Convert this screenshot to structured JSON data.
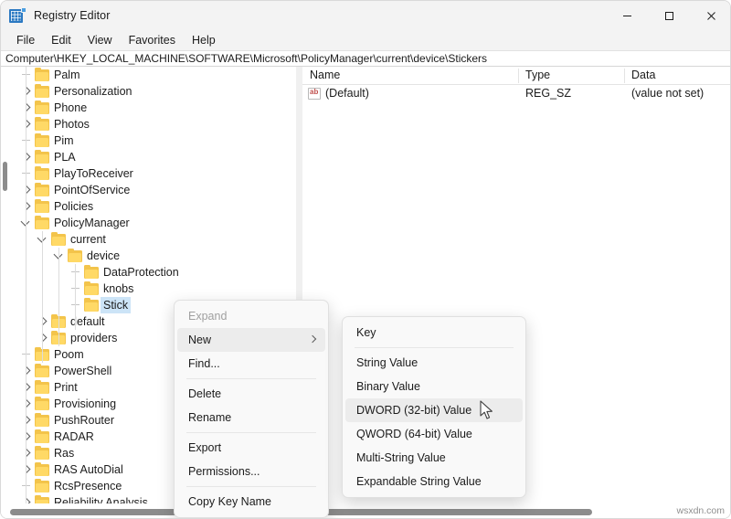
{
  "window": {
    "title": "Registry Editor",
    "icon": "registry-editor-icon",
    "controls": {
      "minimize": "Minimize",
      "maximize": "Maximize",
      "close": "Close"
    }
  },
  "menubar": {
    "items": [
      {
        "label": "File"
      },
      {
        "label": "Edit"
      },
      {
        "label": "View"
      },
      {
        "label": "Favorites"
      },
      {
        "label": "Help"
      }
    ]
  },
  "address": {
    "path": "Computer\\HKEY_LOCAL_MACHINE\\SOFTWARE\\Microsoft\\PolicyManager\\current\\device\\Stickers"
  },
  "tree": {
    "items": [
      {
        "label": "Palm",
        "indent": 1,
        "marker": "leaf",
        "selected": false
      },
      {
        "label": "Personalization",
        "indent": 1,
        "marker": "closed",
        "selected": false
      },
      {
        "label": "Phone",
        "indent": 1,
        "marker": "closed",
        "selected": false
      },
      {
        "label": "Photos",
        "indent": 1,
        "marker": "closed",
        "selected": false
      },
      {
        "label": "Pim",
        "indent": 1,
        "marker": "leaf",
        "selected": false
      },
      {
        "label": "PLA",
        "indent": 1,
        "marker": "closed",
        "selected": false
      },
      {
        "label": "PlayToReceiver",
        "indent": 1,
        "marker": "leaf",
        "selected": false
      },
      {
        "label": "PointOfService",
        "indent": 1,
        "marker": "closed",
        "selected": false
      },
      {
        "label": "Policies",
        "indent": 1,
        "marker": "closed",
        "selected": false
      },
      {
        "label": "PolicyManager",
        "indent": 1,
        "marker": "open",
        "selected": false
      },
      {
        "label": "current",
        "indent": 2,
        "marker": "open",
        "selected": false
      },
      {
        "label": "device",
        "indent": 3,
        "marker": "open",
        "selected": false
      },
      {
        "label": "DataProtection",
        "indent": 4,
        "marker": "leaf",
        "selected": false
      },
      {
        "label": "knobs",
        "indent": 4,
        "marker": "leaf",
        "selected": false
      },
      {
        "label": "Stick",
        "indent": 4,
        "marker": "leaf",
        "selected": true
      },
      {
        "label": "default",
        "indent": 2,
        "marker": "closed",
        "selected": false
      },
      {
        "label": "providers",
        "indent": 2,
        "marker": "closed",
        "selected": false
      },
      {
        "label": "Poom",
        "indent": 1,
        "marker": "leaf",
        "selected": false
      },
      {
        "label": "PowerShell",
        "indent": 1,
        "marker": "closed",
        "selected": false
      },
      {
        "label": "Print",
        "indent": 1,
        "marker": "closed",
        "selected": false
      },
      {
        "label": "Provisioning",
        "indent": 1,
        "marker": "closed",
        "selected": false
      },
      {
        "label": "PushRouter",
        "indent": 1,
        "marker": "closed",
        "selected": false
      },
      {
        "label": "RADAR",
        "indent": 1,
        "marker": "closed",
        "selected": false
      },
      {
        "label": "Ras",
        "indent": 1,
        "marker": "closed",
        "selected": false
      },
      {
        "label": "RAS AutoDial",
        "indent": 1,
        "marker": "closed",
        "selected": false
      },
      {
        "label": "RcsPresence",
        "indent": 1,
        "marker": "leaf",
        "selected": false
      },
      {
        "label": "Reliability Analysis",
        "indent": 1,
        "marker": "closed",
        "selected": false
      }
    ]
  },
  "values": {
    "columns": [
      "Name",
      "Type",
      "Data"
    ],
    "rows": [
      {
        "icon": "string-value-icon",
        "name": "(Default)",
        "type": "REG_SZ",
        "data": "(value not set)"
      }
    ]
  },
  "context_menu": {
    "items": [
      {
        "label": "Expand",
        "state": "disabled",
        "submenu": false
      },
      {
        "label": "New",
        "state": "highlighted",
        "submenu": true
      },
      {
        "label": "Find...",
        "state": "normal",
        "submenu": false
      },
      {
        "label": "-separator-",
        "state": "separator",
        "submenu": false
      },
      {
        "label": "Delete",
        "state": "normal",
        "submenu": false
      },
      {
        "label": "Rename",
        "state": "normal",
        "submenu": false
      },
      {
        "label": "-separator-",
        "state": "separator",
        "submenu": false
      },
      {
        "label": "Export",
        "state": "normal",
        "submenu": false
      },
      {
        "label": "Permissions...",
        "state": "normal",
        "submenu": false
      },
      {
        "label": "-separator-",
        "state": "separator",
        "submenu": false
      },
      {
        "label": "Copy Key Name",
        "state": "normal",
        "submenu": false
      }
    ]
  },
  "submenu": {
    "items": [
      {
        "label": "Key",
        "state": "normal"
      },
      {
        "label": "-separator-",
        "state": "separator"
      },
      {
        "label": "String Value",
        "state": "normal"
      },
      {
        "label": "Binary Value",
        "state": "normal"
      },
      {
        "label": "DWORD (32-bit) Value",
        "state": "highlighted"
      },
      {
        "label": "QWORD (64-bit) Value",
        "state": "normal"
      },
      {
        "label": "Multi-String Value",
        "state": "normal"
      },
      {
        "label": "Expandable String Value",
        "state": "normal"
      }
    ]
  },
  "watermark": {
    "text": "wsxdn.com"
  },
  "colors": {
    "folder": "#f3c44b",
    "selection": "#cce4f7",
    "accent": "#2b79c2",
    "menu_highlight": "#ececec"
  }
}
